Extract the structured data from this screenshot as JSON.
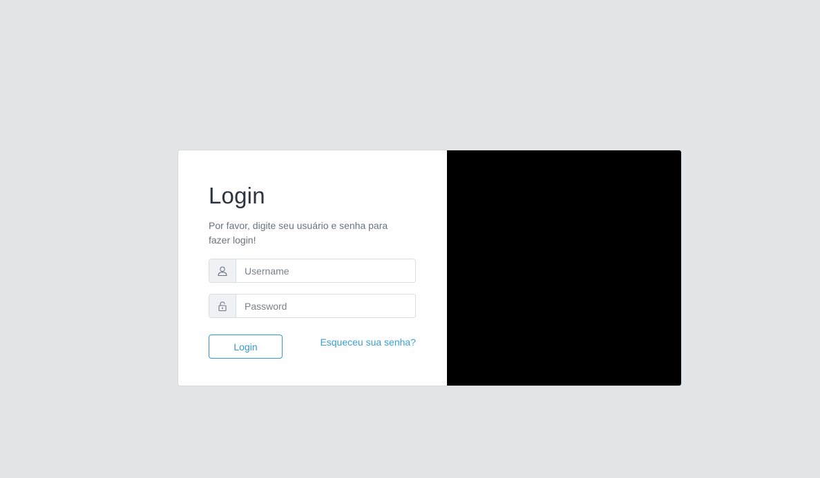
{
  "login": {
    "title": "Login",
    "subtitle": "Por favor, digite seu usuário e senha para fazer login!",
    "username": {
      "placeholder": "Username",
      "value": "",
      "icon": "user-icon"
    },
    "password": {
      "placeholder": "Password",
      "value": "",
      "icon": "lock-icon"
    },
    "submit_label": "Login",
    "forgot_label": "Esqueceu sua senha?"
  },
  "colors": {
    "page_background": "#e4e5e7",
    "card_background": "#ffffff",
    "panel_background": "#000000",
    "accent": "#3399cc",
    "title_text": "#2c3440",
    "muted_text": "#6b7380"
  }
}
